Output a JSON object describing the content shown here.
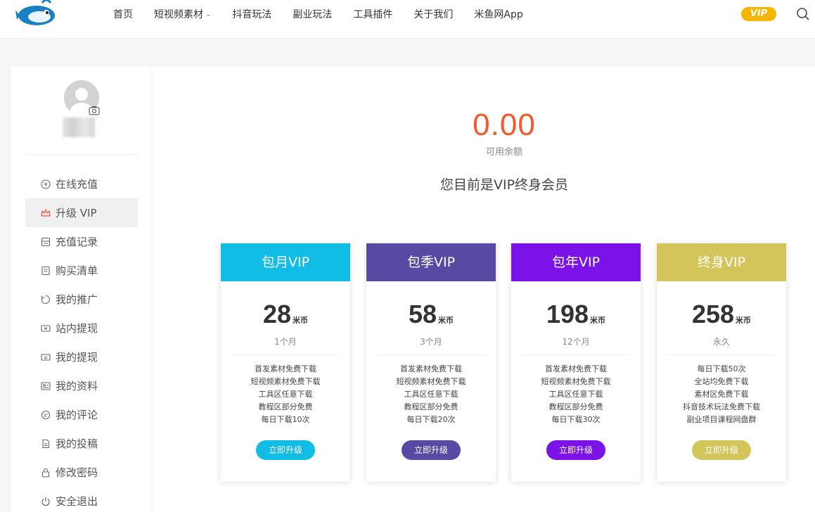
{
  "header": {
    "nav": [
      {
        "label": "首页"
      },
      {
        "label": "短视频素材",
        "has_dropdown": true
      },
      {
        "label": "抖音玩法"
      },
      {
        "label": "副业玩法"
      },
      {
        "label": "工具插件"
      },
      {
        "label": "关于我们"
      },
      {
        "label": "米鱼网App"
      }
    ],
    "vip_badge": "VIP",
    "icons": {
      "search": "search-icon",
      "dropdown": "chevron-down-icon"
    }
  },
  "sidebar": {
    "menu": [
      {
        "label": "在线充值",
        "icon": "yen-icon"
      },
      {
        "label": "升级 VIP",
        "icon": "crown-icon",
        "active": true
      },
      {
        "label": "充值记录",
        "icon": "record-icon"
      },
      {
        "label": "购买清单",
        "icon": "list-icon"
      },
      {
        "label": "我的推广",
        "icon": "promotion-icon"
      },
      {
        "label": "站内提现",
        "icon": "ticket-icon"
      },
      {
        "label": "我的提现",
        "icon": "wallet-icon"
      },
      {
        "label": "我的资料",
        "icon": "profile-card-icon"
      },
      {
        "label": "我的评论",
        "icon": "comment-icon"
      },
      {
        "label": "我的投稿",
        "icon": "document-icon"
      },
      {
        "label": "修改密码",
        "icon": "lock-icon"
      },
      {
        "label": "安全退出",
        "icon": "power-icon"
      }
    ]
  },
  "main": {
    "balance": "0.00",
    "balance_label": "可用余额",
    "member_status": "您目前是VIP终身会员",
    "plans": [
      {
        "name": "包月VIP",
        "price": "28",
        "unit": "米币",
        "period": "1个月",
        "features": [
          "首发素材免费下载",
          "短视频素材免费下载",
          "工具区任意下载",
          "教程区部分免费",
          "每日下载10次"
        ],
        "button": "立即升级",
        "color": "#12bde5"
      },
      {
        "name": "包季VIP",
        "price": "58",
        "unit": "米币",
        "period": "3个月",
        "features": [
          "首发素材免费下载",
          "短视频素材免费下载",
          "工具区任意下载",
          "教程区部分免费",
          "每日下载20次"
        ],
        "button": "立即升级",
        "color": "#574aa2"
      },
      {
        "name": "包年VIP",
        "price": "198",
        "unit": "米币",
        "period": "12个月",
        "features": [
          "首发素材免费下载",
          "短视频素材免费下载",
          "工具区任意下载",
          "教程区部分免费",
          "每日下载30次"
        ],
        "button": "立即升级",
        "color": "#7b12e8"
      },
      {
        "name": "终身VIP",
        "price": "258",
        "unit": "米币",
        "period": "永久",
        "features": [
          "每日下载50次",
          "全站均免费下载",
          "素材区免费下载",
          "抖音技术玩法免费下载",
          "副业项目课程网盘群"
        ],
        "button": "立即升级",
        "color": "#d4c55a"
      }
    ]
  },
  "colors": {
    "accent_orange": "#f25a2b",
    "vip_badge": "#f7b500",
    "crown_red": "#f04e3e"
  }
}
